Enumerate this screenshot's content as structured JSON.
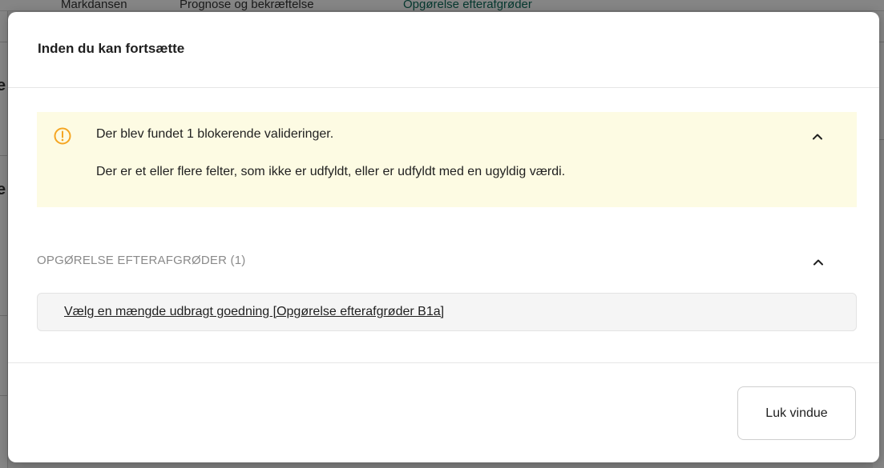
{
  "background": {
    "breadcrumbs": [
      "Markdansen",
      "Prognose og bekræftelse",
      "Opgørelse efterafgrøder"
    ],
    "side_glyphs": [
      "e",
      "e"
    ]
  },
  "modal": {
    "title": "Inden du kan fortsætte",
    "alert": {
      "icon": "warning-circle-icon",
      "heading": "Der blev fundet 1 blokerende valideringer.",
      "body": "Der er et eller flere felter, som ikke er udfyldt, eller er udfyldt med en ugyldig værdi.",
      "color": "#f5a623",
      "background": "#fdfbe3"
    },
    "section": {
      "heading": "OPGØRELSE EFTERAFGRØDER (1)",
      "items": [
        {
          "label": "Vælg en mængde udbragt goedning [Opgørelse efterafgrøder B1a]"
        }
      ]
    },
    "close_label": "Luk vindue"
  }
}
